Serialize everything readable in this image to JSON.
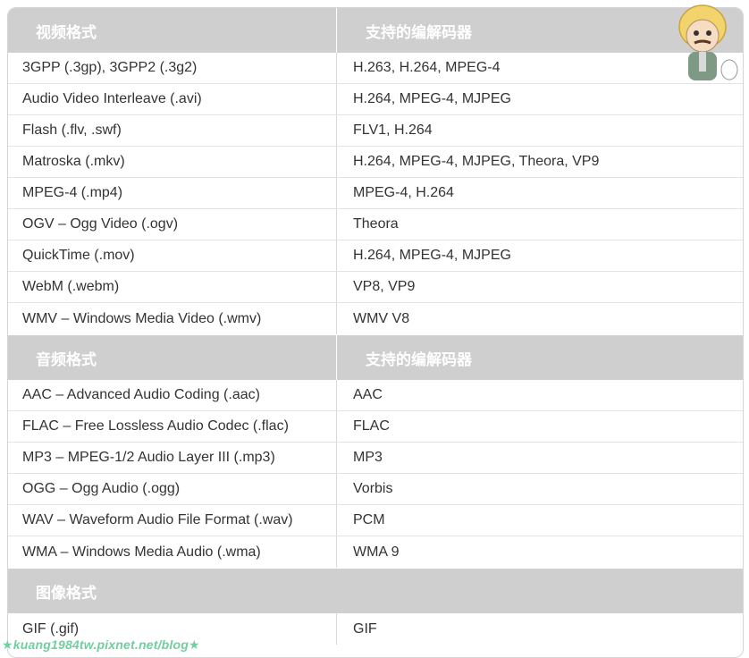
{
  "video": {
    "header": {
      "col1": "视频格式",
      "col2": "支持的编解码器"
    },
    "rows": [
      {
        "format": "3GPP (.3gp), 3GPP2 (.3g2)",
        "codecs": "H.263, H.264, MPEG-4"
      },
      {
        "format": "Audio Video Interleave (.avi)",
        "codecs": "H.264, MPEG-4, MJPEG"
      },
      {
        "format": "Flash (.flv, .swf)",
        "codecs": "FLV1, H.264"
      },
      {
        "format": "Matroska (.mkv)",
        "codecs": "H.264, MPEG-4, MJPEG, Theora, VP9"
      },
      {
        "format": "MPEG-4 (.mp4)",
        "codecs": "MPEG-4, H.264"
      },
      {
        "format": "OGV – Ogg Video (.ogv)",
        "codecs": "Theora"
      },
      {
        "format": "QuickTime (.mov)",
        "codecs": "H.264, MPEG-4, MJPEG"
      },
      {
        "format": "WebM (.webm)",
        "codecs": "VP8, VP9"
      },
      {
        "format": "WMV – Windows Media Video (.wmv)",
        "codecs": "WMV V8"
      }
    ]
  },
  "audio": {
    "header": {
      "col1": "音频格式",
      "col2": "支持的编解码器"
    },
    "rows": [
      {
        "format": "AAC – Advanced Audio Coding (.aac)",
        "codecs": "AAC"
      },
      {
        "format": "FLAC – Free Lossless Audio Codec (.flac)",
        "codecs": "FLAC"
      },
      {
        "format": "MP3 – MPEG-1/2 Audio Layer III (.mp3)",
        "codecs": "MP3"
      },
      {
        "format": "OGG – Ogg Audio (.ogg)",
        "codecs": "Vorbis"
      },
      {
        "format": "WAV – Waveform Audio File Format (.wav)",
        "codecs": "PCM"
      },
      {
        "format": "WMA – Windows Media Audio (.wma)",
        "codecs": "WMA 9"
      }
    ]
  },
  "image": {
    "header": {
      "col1": "图像格式",
      "col2": ""
    },
    "rows": [
      {
        "format": "GIF (.gif)",
        "codecs": "GIF"
      }
    ]
  },
  "watermark": "★kuang1984tw.pixnet.net/blog★",
  "colors": {
    "header_bg": "#cfcfcf",
    "header_text": "#ffffff",
    "row_border": "#e3e3e3",
    "watermark": "#6fcf9f"
  }
}
